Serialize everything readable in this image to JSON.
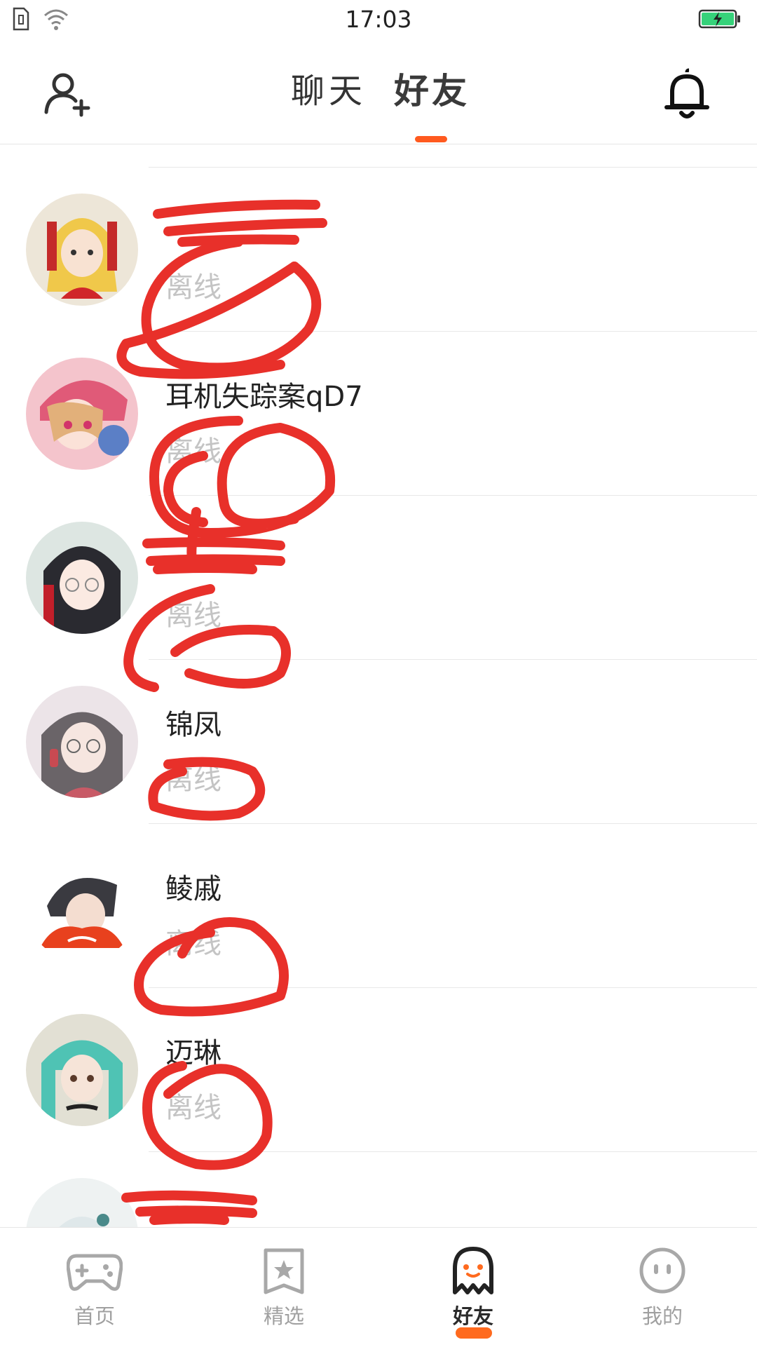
{
  "status_bar": {
    "time": "17:03"
  },
  "header": {
    "tabs": [
      {
        "label": "聊天",
        "active": false
      },
      {
        "label": "好友",
        "active": true
      }
    ],
    "accent": "#ff5a1f"
  },
  "friends": [
    {
      "name": "",
      "status": ""
    },
    {
      "name": "",
      "status": "离线"
    },
    {
      "name": "耳机失踪案qD7",
      "status": "离线"
    },
    {
      "name": "",
      "status": "离线"
    },
    {
      "name": "锦凤",
      "status": "离线"
    },
    {
      "name": "鲮戚",
      "status": "离线"
    },
    {
      "name": "迈琳",
      "status": "离线"
    },
    {
      "name": "",
      "status": ""
    }
  ],
  "bottom_nav": [
    {
      "label": "首页",
      "icon": "gamepad-icon",
      "active": false
    },
    {
      "label": "精选",
      "icon": "star-card-icon",
      "active": false
    },
    {
      "label": "好友",
      "icon": "ghost-icon",
      "active": true
    },
    {
      "label": "我的",
      "icon": "face-icon",
      "active": false
    }
  ],
  "colors": {
    "accent": "#ff6a1e",
    "status_offline": "#c4c4c4",
    "scribble": "#e8302a"
  }
}
